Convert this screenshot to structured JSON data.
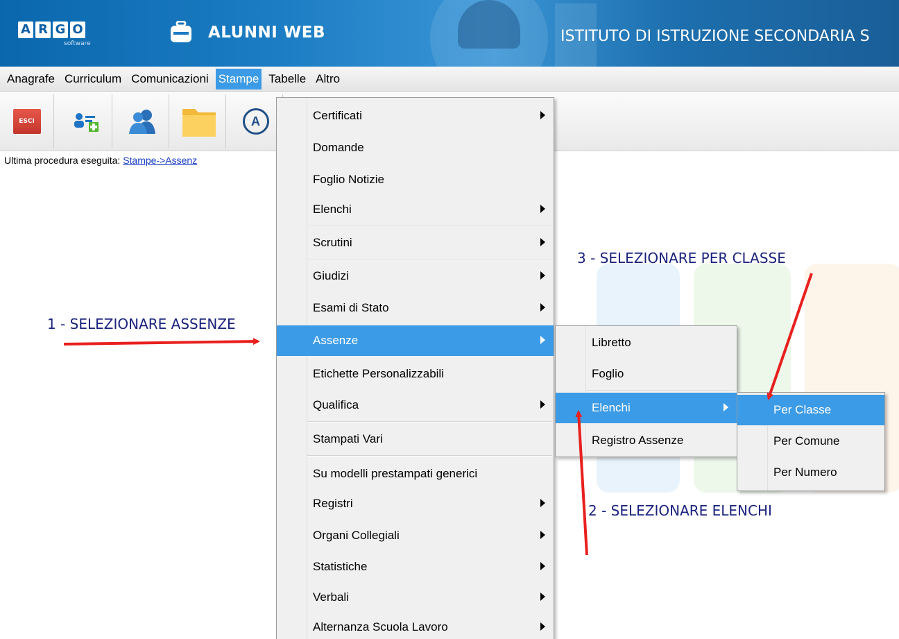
{
  "header": {
    "logo_letters": [
      "A",
      "R",
      "G",
      "O"
    ],
    "logo_sub": "software",
    "app_title": "ALUNNI WEB",
    "school_title": "ISTITUTO DI ISTRUZIONE SECONDARIA S"
  },
  "menubar": {
    "items": [
      "Anagrafe",
      "Curriculum",
      "Comunicazioni",
      "Stampe",
      "Tabelle",
      "Altro"
    ],
    "active": "Stampe"
  },
  "toolbar": {
    "buttons": [
      "exit-button",
      "add-student-button",
      "students-button",
      "folder-button",
      "a-button"
    ],
    "exit_label": "ESCI",
    "a_label": "A"
  },
  "status": {
    "label": "Ultima procedura eseguita:",
    "link": "Stampe->Assenz"
  },
  "stampe_menu": {
    "items": [
      {
        "label": "Certificati",
        "submenu": true
      },
      {
        "label": "Domande",
        "submenu": false
      },
      {
        "label": "Foglio Notizie",
        "submenu": false
      },
      {
        "label": "Elenchi",
        "submenu": true
      },
      {
        "label": "Scrutini",
        "submenu": true
      },
      {
        "label": "Giudizi",
        "submenu": true
      },
      {
        "label": "Esami di Stato",
        "submenu": true
      },
      {
        "label": "Assenze",
        "submenu": true,
        "selected": true
      },
      {
        "label": "Etichette Personalizzabili",
        "submenu": false
      },
      {
        "label": "Qualifica",
        "submenu": true
      },
      {
        "label": "Stampati Vari",
        "submenu": false
      },
      {
        "label": "Su modelli prestampati generici",
        "submenu": false
      },
      {
        "label": "Registri",
        "submenu": true
      },
      {
        "label": "Organi Collegiali",
        "submenu": true
      },
      {
        "label": "Statistiche",
        "submenu": true
      },
      {
        "label": "Verbali",
        "submenu": true
      },
      {
        "label": "Alternanza Scuola Lavoro",
        "submenu": true
      }
    ]
  },
  "assenze_menu": {
    "items": [
      {
        "label": "Libretto",
        "submenu": false
      },
      {
        "label": "Foglio",
        "submenu": false
      },
      {
        "label": "Elenchi",
        "submenu": true,
        "selected": true
      },
      {
        "label": "Registro Assenze",
        "submenu": false
      }
    ]
  },
  "elenchi_menu": {
    "items": [
      {
        "label": "Per Classe",
        "selected": true
      },
      {
        "label": "Per Comune"
      },
      {
        "label": "Per Numero"
      }
    ]
  },
  "annotations": {
    "step1": "1 - SELEZIONARE ASSENZE",
    "step2": "2 - SELEZIONARE ELENCHI",
    "step3": "3 - SELEZIONARE PER CLASSE"
  },
  "colors": {
    "menu_highlight": "#3c9be6",
    "annotation_text": "#1a237e",
    "annotation_arrow": "#e8201e",
    "header_blue": "#1b7cc3"
  }
}
